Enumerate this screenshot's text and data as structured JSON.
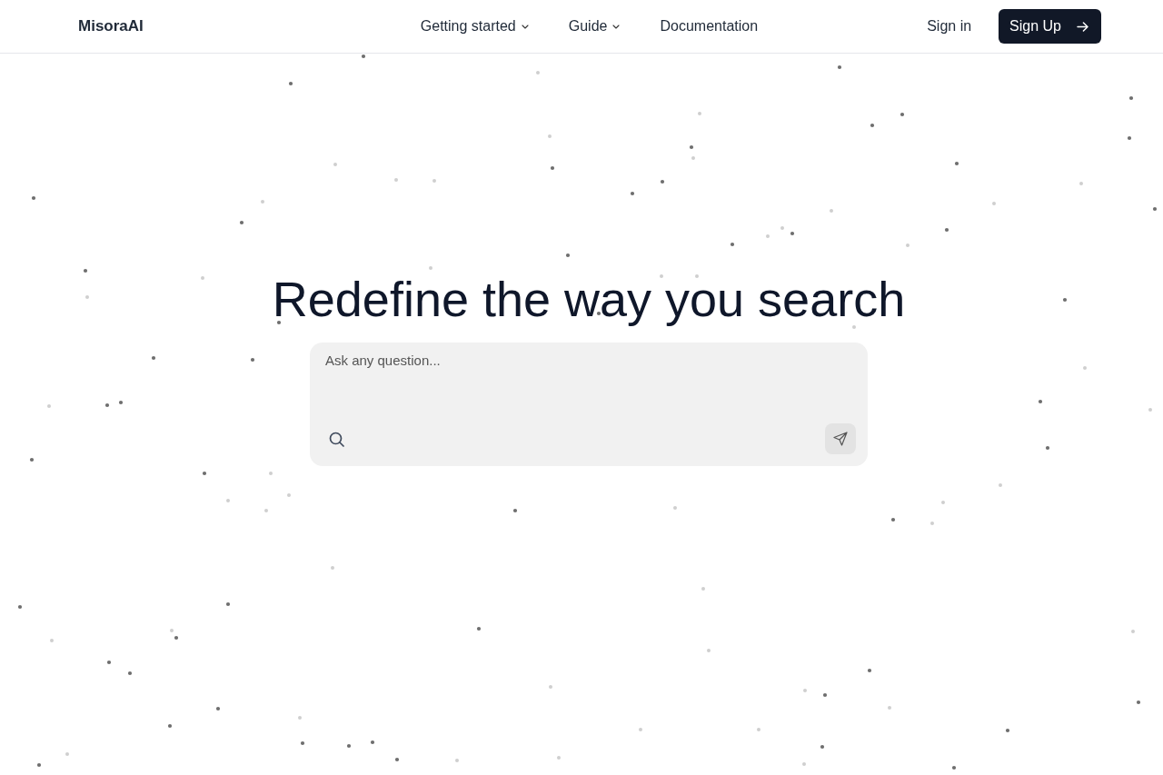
{
  "nav": {
    "logo": "MisoraAI",
    "links": [
      {
        "label": "Getting started",
        "kind": "dropdown"
      },
      {
        "label": "Guide",
        "kind": "dropdown"
      },
      {
        "label": "Documentation",
        "kind": "link"
      }
    ],
    "sign_in": "Sign in",
    "sign_up": "Sign Up"
  },
  "hero": {
    "title": "Redefine the way you search",
    "search": {
      "placeholder": "Ask any question..."
    }
  }
}
